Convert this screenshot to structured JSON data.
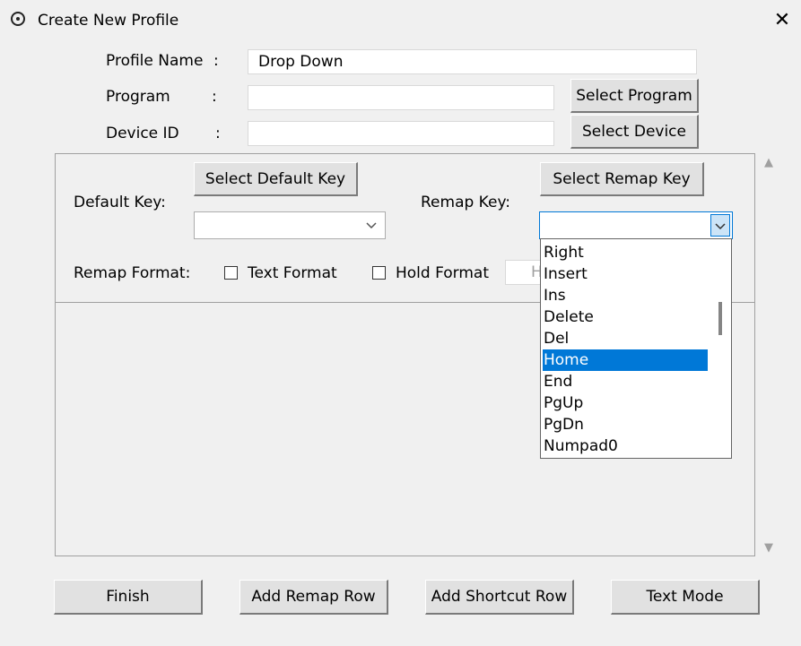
{
  "window": {
    "title": "Create New Profile",
    "close_glyph": "✕"
  },
  "form": {
    "profile_name_label": "Profile Name",
    "program_label": "Program",
    "device_id_label": "Device ID",
    "colon": ":",
    "profile_name_value": "Drop Down",
    "program_value": "",
    "device_id_value": "",
    "select_program_label": "Select Program",
    "select_device_label": "Select Device"
  },
  "mapping": {
    "default_key_label": "Default Key:",
    "select_default_key_label": "Select Default Key",
    "default_key_value": "",
    "remap_key_label": "Remap Key:",
    "select_remap_key_label": "Select Remap Key",
    "remap_key_value": "",
    "remap_format_label": "Remap Format:",
    "text_format_label": "Text Format",
    "hold_format_label": "Hold Format",
    "hold_value_partial": "H",
    "text_format_checked": false,
    "hold_format_checked": false
  },
  "dropdown": {
    "items": [
      "Right",
      "Insert",
      "Ins",
      "Delete",
      "Del",
      "Home",
      "End",
      "PgUp",
      "PgDn",
      "Numpad0"
    ],
    "selected": "Home"
  },
  "footer": {
    "finish_label": "Finish",
    "add_remap_row_label": "Add Remap Row",
    "add_shortcut_row_label": "Add Shortcut Row",
    "text_mode_label": "Text Mode"
  },
  "icons": {
    "app_icon": "radio-circle-icon",
    "combo_arrow": "chevron-down-icon",
    "scroll_up": "scroll-up-icon",
    "scroll_down": "scroll-down-icon"
  },
  "colors": {
    "selection": "#0078d7",
    "background": "#f0f0f0"
  }
}
